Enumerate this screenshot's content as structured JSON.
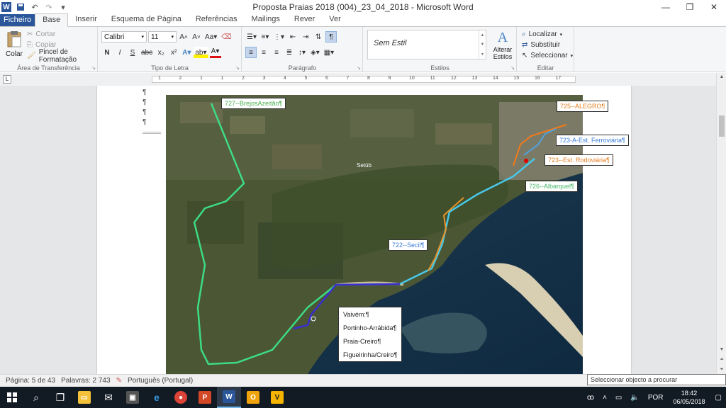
{
  "window": {
    "title": "Proposta Praias 2018 (004)_23_04_2018  -  Microsoft Word",
    "minimize": "—",
    "restore": "❐",
    "close": "✕"
  },
  "tabs": [
    "Ficheiro",
    "Base",
    "Inserir",
    "Esquema de Página",
    "Referências",
    "Mailings",
    "Rever",
    "Ver"
  ],
  "ribbon": {
    "clipboard": {
      "label": "Área de Transferência",
      "paste": "Colar",
      "cut": "Cortar",
      "copy": "Copiar",
      "format_painter": "Pincel de Formatação"
    },
    "font": {
      "label": "Tipo de Letra",
      "font_name": "Calibri",
      "font_size": "11",
      "buttons": [
        "N",
        "I",
        "S",
        "abc",
        "x₂",
        "x²"
      ]
    },
    "paragraph": {
      "label": "Parágrafo"
    },
    "styles": {
      "label": "Estilos",
      "current": "Sem Estil",
      "change": "Alterar",
      "change2": "Estilos"
    },
    "editing": {
      "label": "Editar",
      "find": "Localizar",
      "replace": "Substituir",
      "select": "Seleccionar"
    }
  },
  "ruler": {
    "numbers": [
      "1",
      "2",
      "1",
      "1",
      "2",
      "3",
      "4",
      "5",
      "6",
      "7",
      "8",
      "9",
      "10",
      "11",
      "12",
      "13",
      "14",
      "15",
      "16",
      "17"
    ]
  },
  "document": {
    "pilcrows": [
      "¶",
      "¶",
      "¶",
      "¶"
    ],
    "map_labels": {
      "l727": "727--BrejosAzeitão¶",
      "l725": "725--ALEGRO¶",
      "l723a": "723-A-Est. Ferroviária¶",
      "l723": "723--Est. Rodoviária¶",
      "l726": "726--Albarquel¶",
      "l722": "722--Secil¶",
      "town": "Setúb"
    },
    "info_box": [
      "Vaivém:¶",
      "Portinho-Arrábida¶",
      "Praia-Creiro¶",
      "Figueirinha/Creiro¶"
    ]
  },
  "colors": {
    "route_727": "#3ddc84",
    "route_725": "#f07a1a",
    "route_723": "#4fa3e0",
    "route_722": "#e8942c",
    "route_726": "#48c8e8",
    "vaivem": "#3a2fd0",
    "word_blue": "#2b579a"
  },
  "status": {
    "page": "Página: 5 de 43",
    "words": "Palavras: 2 743",
    "language": "Português (Portugal)",
    "tooltip": "Seleccionar objecto a procurar (Alt+Ctrl+Home)"
  },
  "taskbar": {
    "time": "18:42",
    "date": "06/05/2018",
    "lang": "POR",
    "apps": [
      "start-icon",
      "search-icon",
      "task-view-icon",
      "file-explorer-icon",
      "mail-icon",
      "store-icon",
      "edge-icon",
      "chrome-icon",
      "powerpoint-icon",
      "word-icon",
      "outlook-icon",
      "vectorworks-icon"
    ]
  }
}
